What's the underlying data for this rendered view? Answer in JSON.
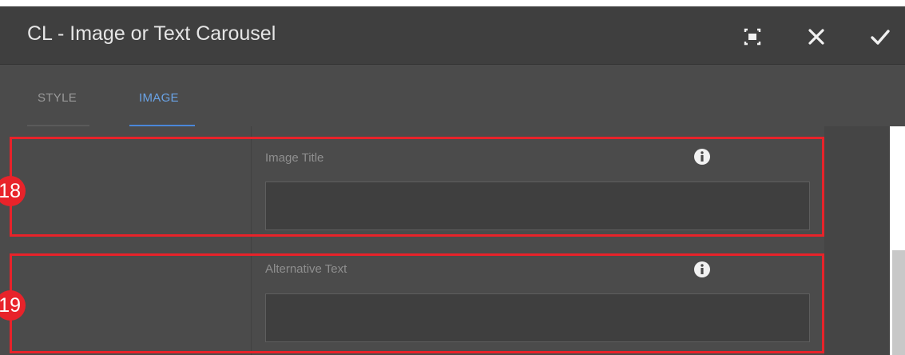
{
  "dialog": {
    "title": "CL - Image or Text Carousel",
    "buttons": {
      "fullscreen_icon": "fullscreen-icon",
      "close_icon": "close-icon",
      "confirm_icon": "checkmark-icon"
    }
  },
  "tabs": [
    {
      "label": "STYLE",
      "active": false
    },
    {
      "label": "IMAGE",
      "active": true
    }
  ],
  "fields": [
    {
      "label": "Image Title",
      "value": "",
      "annotation": "18"
    },
    {
      "label": "Alternative Text",
      "value": "",
      "annotation": "19"
    }
  ],
  "colors": {
    "accent": "#6aa3e6",
    "highlight": "#e8232a",
    "header_bg": "#3f3f3f",
    "panel_bg": "#4b4b4b"
  }
}
